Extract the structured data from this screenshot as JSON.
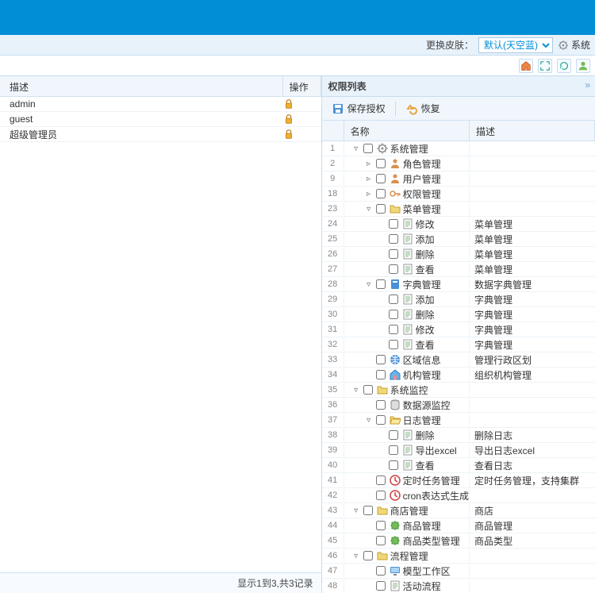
{
  "skin": {
    "label": "更换皮肤：",
    "selected": "默认(天空蓝)",
    "system": "系统"
  },
  "left": {
    "headers": {
      "desc": "描述",
      "op": "操作"
    },
    "rows": [
      {
        "desc": "admin"
      },
      {
        "desc": "guest"
      },
      {
        "desc": "超级管理员"
      }
    ],
    "footer": "显示1到3,共3记录"
  },
  "right": {
    "title": "权限列表",
    "toolbar": {
      "save": "保存授权",
      "revert": "恢复"
    },
    "headers": {
      "name": "名称",
      "desc": "描述"
    },
    "rows": [
      {
        "num": "1",
        "level": 0,
        "exp": "▿",
        "icon": "gear",
        "name": "系统管理",
        "desc": ""
      },
      {
        "num": "2",
        "level": 1,
        "exp": "▹",
        "icon": "user",
        "name": "角色管理",
        "desc": ""
      },
      {
        "num": "9",
        "level": 1,
        "exp": "▹",
        "icon": "user",
        "name": "用户管理",
        "desc": ""
      },
      {
        "num": "18",
        "level": 1,
        "exp": "▹",
        "icon": "key",
        "name": "权限管理",
        "desc": ""
      },
      {
        "num": "23",
        "level": 1,
        "exp": "▿",
        "icon": "folder",
        "name": "菜单管理",
        "desc": ""
      },
      {
        "num": "24",
        "level": 2,
        "exp": "",
        "icon": "page",
        "name": "修改",
        "desc": "菜单管理"
      },
      {
        "num": "25",
        "level": 2,
        "exp": "",
        "icon": "page",
        "name": "添加",
        "desc": "菜单管理"
      },
      {
        "num": "26",
        "level": 2,
        "exp": "",
        "icon": "page",
        "name": "删除",
        "desc": "菜单管理"
      },
      {
        "num": "27",
        "level": 2,
        "exp": "",
        "icon": "page",
        "name": "查看",
        "desc": "菜单管理"
      },
      {
        "num": "28",
        "level": 1,
        "exp": "▿",
        "icon": "book",
        "name": "字典管理",
        "desc": "数据字典管理"
      },
      {
        "num": "29",
        "level": 2,
        "exp": "",
        "icon": "page",
        "name": "添加",
        "desc": "字典管理"
      },
      {
        "num": "30",
        "level": 2,
        "exp": "",
        "icon": "page",
        "name": "删除",
        "desc": "字典管理"
      },
      {
        "num": "31",
        "level": 2,
        "exp": "",
        "icon": "page",
        "name": "修改",
        "desc": "字典管理"
      },
      {
        "num": "32",
        "level": 2,
        "exp": "",
        "icon": "page",
        "name": "查看",
        "desc": "字典管理"
      },
      {
        "num": "33",
        "level": 1,
        "exp": "",
        "icon": "globe",
        "name": "区域信息",
        "desc": "管理行政区划"
      },
      {
        "num": "34",
        "level": 1,
        "exp": "",
        "icon": "home",
        "name": "机构管理",
        "desc": "组织机构管理"
      },
      {
        "num": "35",
        "level": 0,
        "exp": "▿",
        "icon": "folder",
        "name": "系统监控",
        "desc": ""
      },
      {
        "num": "36",
        "level": 1,
        "exp": "",
        "icon": "db",
        "name": "数据源监控",
        "desc": ""
      },
      {
        "num": "37",
        "level": 1,
        "exp": "▿",
        "icon": "folder-open",
        "name": "日志管理",
        "desc": ""
      },
      {
        "num": "38",
        "level": 2,
        "exp": "",
        "icon": "page",
        "name": "删除",
        "desc": "删除日志"
      },
      {
        "num": "39",
        "level": 2,
        "exp": "",
        "icon": "page",
        "name": "导出excel",
        "desc": "导出日志excel"
      },
      {
        "num": "40",
        "level": 2,
        "exp": "",
        "icon": "page",
        "name": "查看",
        "desc": "查看日志"
      },
      {
        "num": "41",
        "level": 1,
        "exp": "",
        "icon": "clock",
        "name": "定时任务管理",
        "desc": "定时任务管理，支持集群"
      },
      {
        "num": "42",
        "level": 1,
        "exp": "",
        "icon": "clock",
        "name": "cron表达式生成",
        "desc": ""
      },
      {
        "num": "43",
        "level": 0,
        "exp": "▿",
        "icon": "folder",
        "name": "商店管理",
        "desc": "商店"
      },
      {
        "num": "44",
        "level": 1,
        "exp": "",
        "icon": "puzzle",
        "name": "商品管理",
        "desc": "商品管理"
      },
      {
        "num": "45",
        "level": 1,
        "exp": "",
        "icon": "puzzle",
        "name": "商品类型管理",
        "desc": "商品类型"
      },
      {
        "num": "46",
        "level": 0,
        "exp": "▿",
        "icon": "folder",
        "name": "流程管理",
        "desc": ""
      },
      {
        "num": "47",
        "level": 1,
        "exp": "",
        "icon": "monitor",
        "name": "模型工作区",
        "desc": ""
      },
      {
        "num": "48",
        "level": 1,
        "exp": "",
        "icon": "page",
        "name": "活动流程",
        "desc": ""
      }
    ]
  }
}
